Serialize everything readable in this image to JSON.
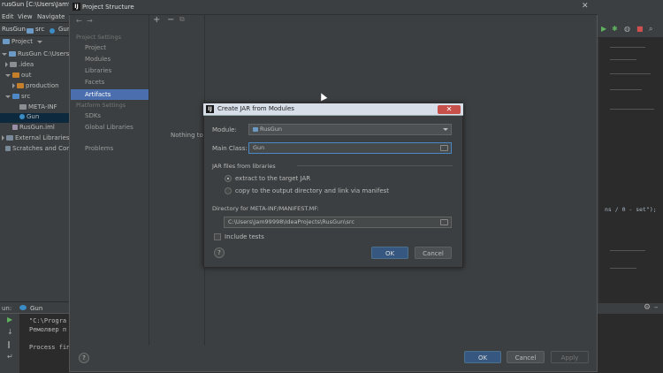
{
  "ide": {
    "title": "rusGun [C:\\Users\\Jam99998...",
    "menu": [
      "Edit",
      "View",
      "Navigate"
    ],
    "nav": [
      "RusGun",
      "src",
      "Gun"
    ],
    "project_label": "Project",
    "tree": [
      {
        "label": "RusGun  C:\\Users\\Ja",
        "depth": 0,
        "kind": "module"
      },
      {
        "label": ".idea",
        "depth": 1,
        "kind": "folder"
      },
      {
        "label": "out",
        "depth": 1,
        "kind": "folder-orange"
      },
      {
        "label": "production",
        "depth": 2,
        "kind": "folder-orange"
      },
      {
        "label": "src",
        "depth": 1,
        "kind": "folder-blue"
      },
      {
        "label": "META-INF",
        "depth": 2,
        "kind": "folder"
      },
      {
        "label": "Gun",
        "depth": 2,
        "kind": "class"
      },
      {
        "label": "RusGun.iml",
        "depth": 1,
        "kind": "file"
      },
      {
        "label": "External Libraries",
        "depth": 0,
        "kind": "lib"
      },
      {
        "label": "Scratches and Consol",
        "depth": 0,
        "kind": "scratch"
      }
    ],
    "run": {
      "tab_prefix": "un:",
      "tab": "Gun",
      "lines": [
        "\"C:\\Progra",
        "Ремолвер п",
        "Process fin"
      ]
    },
    "right_code_snippet": "ns / 0 - set\");",
    "colors": {
      "accent": "#4b6eaf",
      "selected_tree": "#0d293e",
      "panel": "#3c3f41",
      "editor": "#2b2b2b"
    }
  },
  "project_structure": {
    "title": "Project Structure",
    "sections": [
      {
        "heading": "Project Settings",
        "items": [
          "Project",
          "Modules",
          "Libraries",
          "Facets",
          "Artifacts"
        ]
      },
      {
        "heading": "Platform Settings",
        "items": [
          "SDKs",
          "Global Libraries"
        ]
      }
    ],
    "problems": "Problems",
    "selected": "Artifacts",
    "nothing_text": "Nothing to",
    "toolbar": {
      "add": "+",
      "remove": "−",
      "copy": "⧉"
    },
    "buttons": {
      "ok": "OK",
      "cancel": "Cancel",
      "apply": "Apply",
      "help": "?"
    }
  },
  "jar_dialog": {
    "title": "Create JAR from Modules",
    "module_label": "Module:",
    "module_value": "RusGun",
    "main_class_label": "Main Class:",
    "main_class_value": "Gun",
    "group_label": "JAR files from libraries",
    "radio_extract": "extract to the target JAR",
    "radio_copy": "copy to the output directory and link via manifest",
    "manifest_label": "Directory for META-INF/MANIFEST.MF:",
    "manifest_value": "C:\\Users\\Jam99998\\IdeaProjects\\RusGun\\src",
    "include_tests": "Include tests",
    "ok": "OK",
    "cancel": "Cancel",
    "help": "?"
  }
}
